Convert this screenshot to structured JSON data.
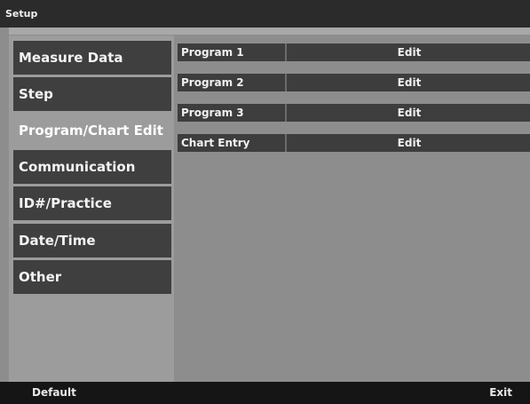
{
  "window": {
    "title": "Setup"
  },
  "menu": {
    "items": [
      {
        "label": "Measure Data",
        "active": false
      },
      {
        "label": "Step",
        "active": false
      },
      {
        "label": "Program/Chart Edit",
        "active": true
      },
      {
        "label": "Communication",
        "active": false
      },
      {
        "label": "ID#/Practice",
        "active": false
      },
      {
        "label": "Date/Time",
        "active": false
      },
      {
        "label": "Other",
        "active": false
      }
    ]
  },
  "panel": {
    "rows": [
      {
        "label": "Program 1",
        "action": "Edit"
      },
      {
        "label": "Program 2",
        "action": "Edit"
      },
      {
        "label": "Program 3",
        "action": "Edit"
      },
      {
        "label": "Chart Entry",
        "action": "Edit"
      }
    ]
  },
  "footer": {
    "left_label": "Default",
    "right_label": "Exit"
  },
  "colors": {
    "titlebar": "#2b2b2b",
    "background": "#8d8d8d",
    "menu_item": "#3f3f3f",
    "menu_active": "#9c9c9c",
    "footer": "#151515"
  }
}
